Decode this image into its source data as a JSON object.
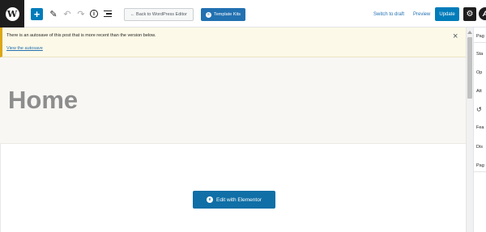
{
  "toolbar": {
    "logo_letter": "W",
    "add_icon": "plus-icon",
    "add_glyph": "+",
    "tools_icon": "pencil-icon",
    "tools_glyph": "✎",
    "undo_icon": "undo-icon",
    "undo_glyph": "↶",
    "redo_icon": "redo-icon",
    "redo_glyph": "↷",
    "info_icon": "info-icon",
    "info_glyph": "i",
    "outline_icon": "list-view-icon",
    "back_label": "← Back to WordPress Editor",
    "kits_label": "Template Kits",
    "kits_glyph": "≡",
    "switch_draft_label": "Switch to draft",
    "preview_label": "Preview",
    "update_label": "Update",
    "settings_icon": "gear-icon",
    "settings_glyph": "⚙",
    "astra_icon": "astra-icon",
    "astra_glyph": "A"
  },
  "notice": {
    "text": "There is an autosave of this post that is more recent than the version below.",
    "link": "View the autosave",
    "close_glyph": "×"
  },
  "page": {
    "title": "Home"
  },
  "elementor": {
    "button_label": "Edit with Elementor",
    "icon_glyph": "e"
  },
  "sidebar": {
    "items": [
      {
        "label": "Pag"
      },
      {
        "label": "Sta"
      },
      {
        "label": "Op"
      },
      {
        "label": "Att"
      },
      {
        "label": "↺"
      },
      {
        "label": "Fea"
      },
      {
        "label": "Dis"
      },
      {
        "label": "Pag"
      }
    ]
  },
  "colors": {
    "accent": "#007cba",
    "notice_border": "#dba617",
    "notice_bg": "#fcf9e8"
  }
}
